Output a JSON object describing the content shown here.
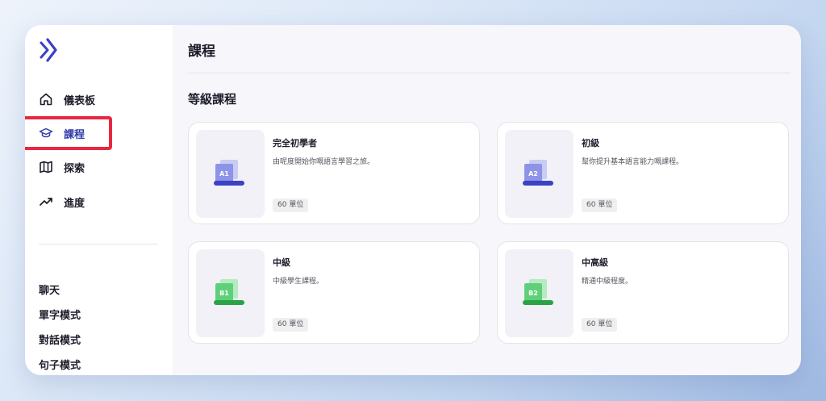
{
  "sidebar": {
    "nav": [
      {
        "label": "儀表板",
        "icon": "home-icon"
      },
      {
        "label": "課程",
        "icon": "graduation-cap-icon",
        "active": true
      },
      {
        "label": "探索",
        "icon": "map-icon"
      },
      {
        "label": "進度",
        "icon": "trending-up-icon"
      }
    ],
    "modes": [
      "聊天",
      "單字模式",
      "對話模式",
      "句子模式"
    ]
  },
  "main": {
    "page_title": "課程",
    "section_title": "等級課程",
    "courses": [
      {
        "level": "A1",
        "title": "完全初學者",
        "description": "由呢度開始你嘅語言學習之旅。",
        "units": "60 單位",
        "color": "#5b63d9"
      },
      {
        "level": "A2",
        "title": "初級",
        "description": "幫你提升基本語言能力嘅課程。",
        "units": "60 單位",
        "color": "#5b63d9"
      },
      {
        "level": "B1",
        "title": "中級",
        "description": "中級學生課程。",
        "units": "60 單位",
        "color": "#3fc05a"
      },
      {
        "level": "B2",
        "title": "中高級",
        "description": "精通中級程度。",
        "units": "60 單位",
        "color": "#3fc05a"
      }
    ]
  },
  "colors": {
    "accent": "#2f3aa8",
    "highlight": "#e8283f",
    "beginner": "#5b63d9",
    "intermediate": "#3fc05a"
  }
}
